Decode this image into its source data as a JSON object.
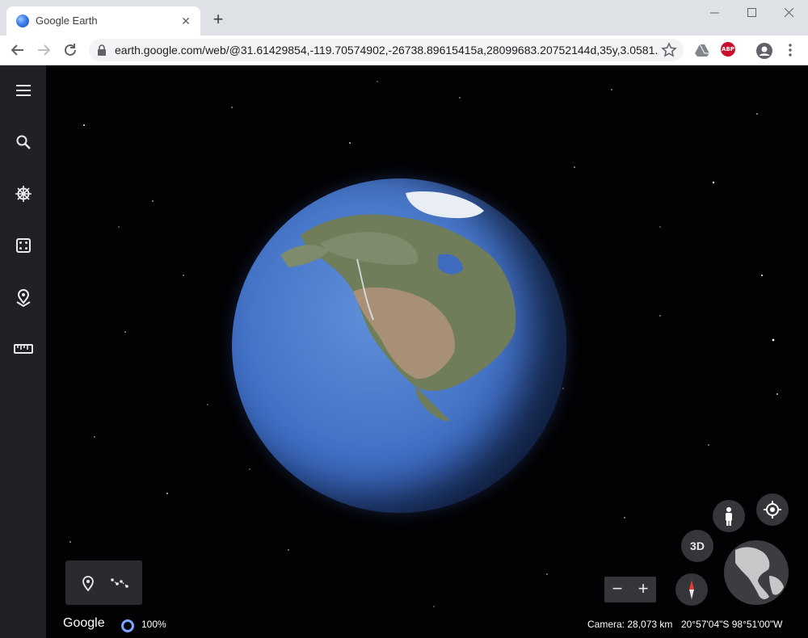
{
  "browser": {
    "tab_title": "Google Earth",
    "tab_close": "✕",
    "new_tab": "+",
    "url": "earth.google.com/web/@31.61429854,-119.70574902,-26738.89615415a,28099683.20752144d,35y,3.0581...",
    "extensions": [
      "google-drive-icon",
      "adblock-plus-icon",
      "account-icon",
      "menu-dots-icon"
    ],
    "abp_label": "ABP"
  },
  "sidebar": {
    "items": [
      "menu-icon",
      "search-icon",
      "voyager-icon",
      "feeling-lucky-icon",
      "projects-icon",
      "measure-icon"
    ]
  },
  "map": {
    "buttons_3d": "3D",
    "zoom_out": "−",
    "zoom_in": "+",
    "logo": "Google",
    "loading": "100%",
    "camera": "Camera: 28,073 km",
    "coordinates": "20°57'04\"S 98°51'00\"W"
  },
  "colors": {
    "sidebar": "#202124",
    "space": "#020204",
    "ocean": "#4675c8",
    "accent": "#7aa8ff"
  }
}
